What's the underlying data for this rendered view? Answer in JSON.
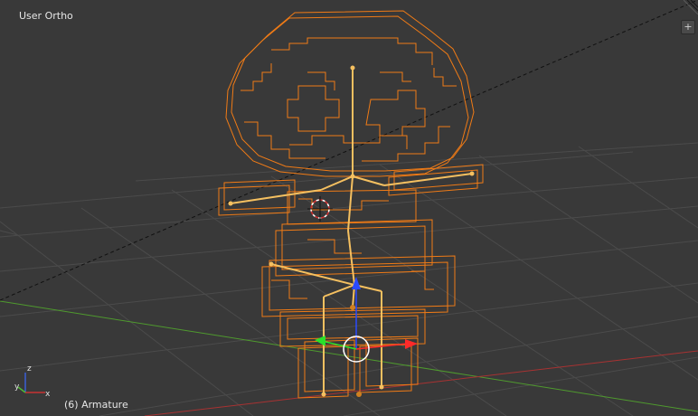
{
  "viewport": {
    "view_name": "User Ortho",
    "status": "(6) Armature",
    "background": "#393939",
    "grid_color": "#4b4b4b",
    "x_axis_color": "#a83232",
    "y_axis_color": "#4f9a2e",
    "selection_color": "#f07b16",
    "bone_color": "#f5c060",
    "corner_widget_label": "+"
  },
  "gizmo": {
    "x_label": "x",
    "y_label": "y",
    "z_label": "z",
    "x_color": "#c83232",
    "y_color": "#4fbb34",
    "z_color": "#3a5fd6"
  },
  "transform_manipulator": {
    "x_handle_color": "#ff2a2a",
    "y_handle_color": "#2ae02a",
    "z_handle_color": "#2a4aff"
  }
}
